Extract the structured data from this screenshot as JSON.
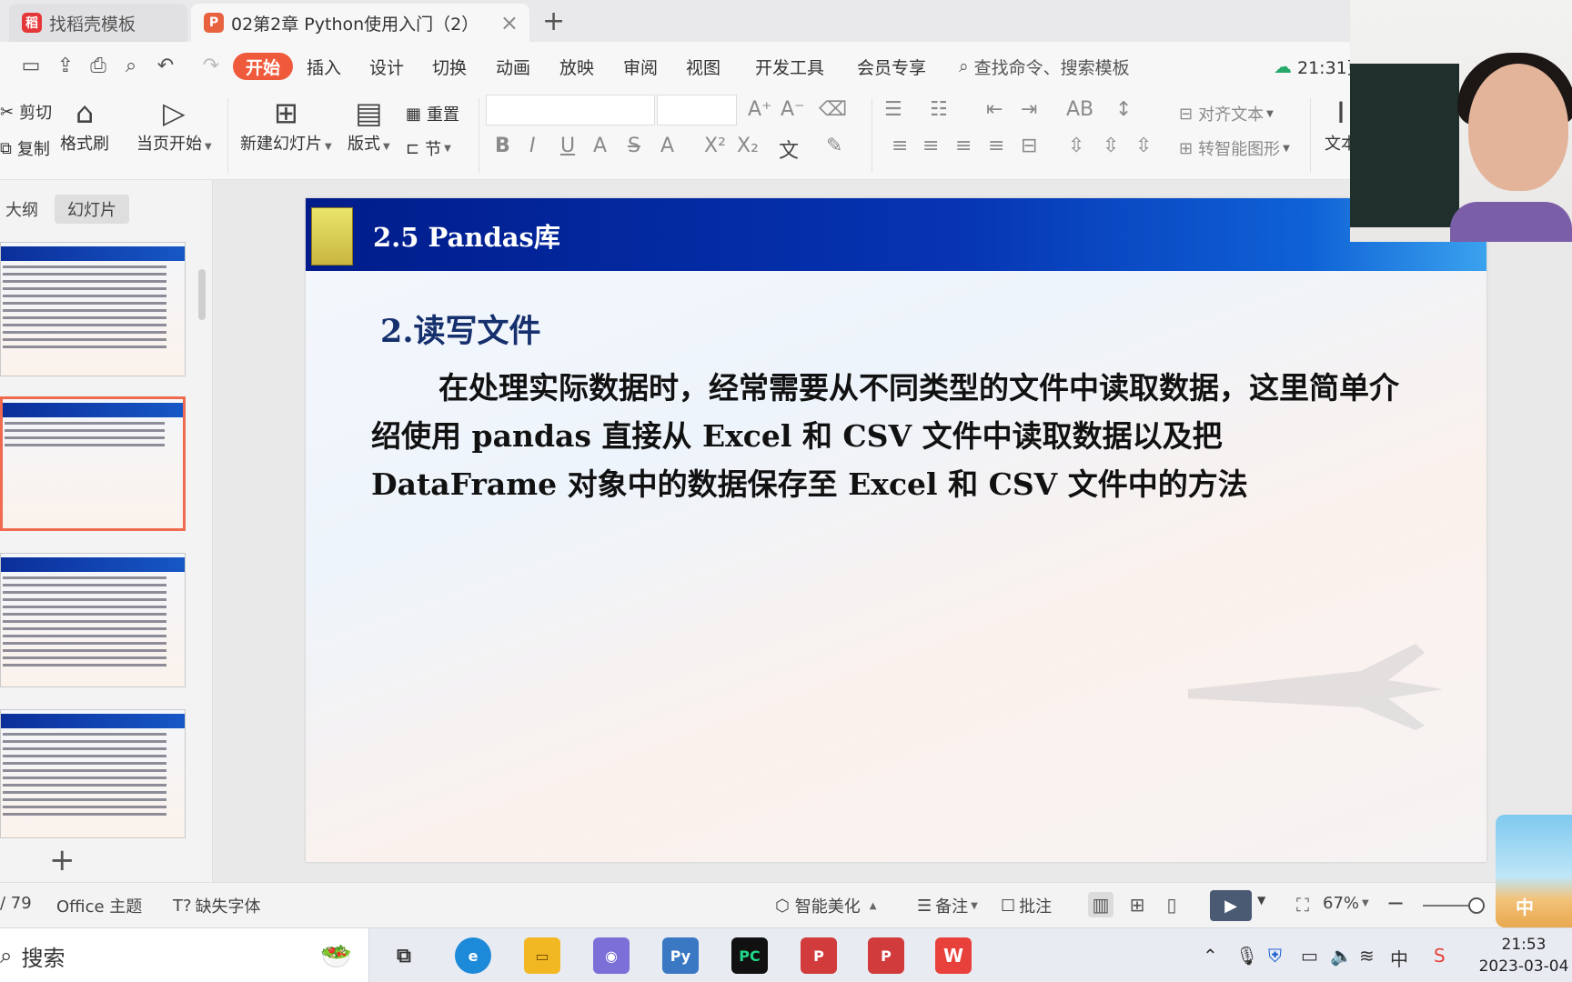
{
  "tabs": [
    {
      "label": "找稻壳模板",
      "icon": "docer-icon"
    },
    {
      "label": "02第2章  Python使用入门（2）",
      "icon": "wps-presentation-icon"
    }
  ],
  "menu": {
    "items": [
      "开始",
      "插入",
      "设计",
      "切换",
      "动画",
      "放映",
      "审阅",
      "视图",
      "开发工具",
      "会员专享"
    ],
    "search_placeholder": "查找命令、搜索模板",
    "time": "21:31更"
  },
  "ribbon": {
    "cut": "剪切",
    "copy": "复制",
    "format_painter": "格式刷",
    "from_current": "当页开始",
    "new_slide": "新建幻灯片",
    "layout": "版式",
    "reset": "重置",
    "section": "节",
    "align_text": "对齐文本",
    "smart_art": "转智能图形",
    "text": "文本"
  },
  "left_pane": {
    "tab_outline": "大纲",
    "tab_slides": "幻灯片"
  },
  "slide": {
    "title": "2.5 Pandas库",
    "subhead": "2.读写文件",
    "body": "在处理实际数据时，经常需要从不同类型的文件中读取数据，这里简单介绍使用 pandas 直接从 Excel 和 CSV 文件中读取数据以及把 DataFrame 对象中的数据保存至 Excel 和 CSV 文件中的方法"
  },
  "status": {
    "page": "/ 79",
    "theme": "Office 主题",
    "missing_font": "缺失字体",
    "beautify": "智能美化",
    "notes": "备注",
    "comments": "批注",
    "zoom": "67%"
  },
  "taskbar": {
    "search": "搜索",
    "time": "21:53",
    "date": "2023-03-04",
    "ime": "中"
  },
  "colors": {
    "accent": "#f05a3c",
    "slide_header": "#0634b3"
  }
}
